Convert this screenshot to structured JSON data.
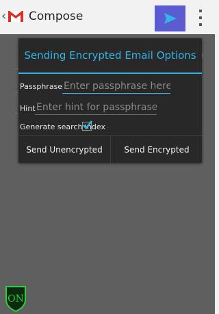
{
  "actionbar": {
    "title": "Compose",
    "icons": {
      "back": "chevron-left-icon",
      "app": "gmail-logo-icon",
      "send": "send-icon",
      "overflow": "overflow-menu-icon"
    },
    "colors": {
      "send_bg": "#5b5cd1",
      "send_arrow": "#33b5e5"
    }
  },
  "dialog": {
    "title": "Sending Encrypted Email Options",
    "passphrase": {
      "label": "Passphrase",
      "placeholder": "Enter passphrase here",
      "value": ""
    },
    "hint": {
      "label": "Hint",
      "placeholder": "Enter hint for passphrase",
      "value": ""
    },
    "search_index": {
      "label": "Generate search index",
      "checked": true
    },
    "buttons": {
      "unencrypted": "Send Unencrypted",
      "encrypted": "Send Encrypted"
    },
    "colors": {
      "accent": "#33b5e5",
      "background": "#282828"
    }
  },
  "badge": {
    "text": "ON",
    "color": "#2ecc40"
  }
}
